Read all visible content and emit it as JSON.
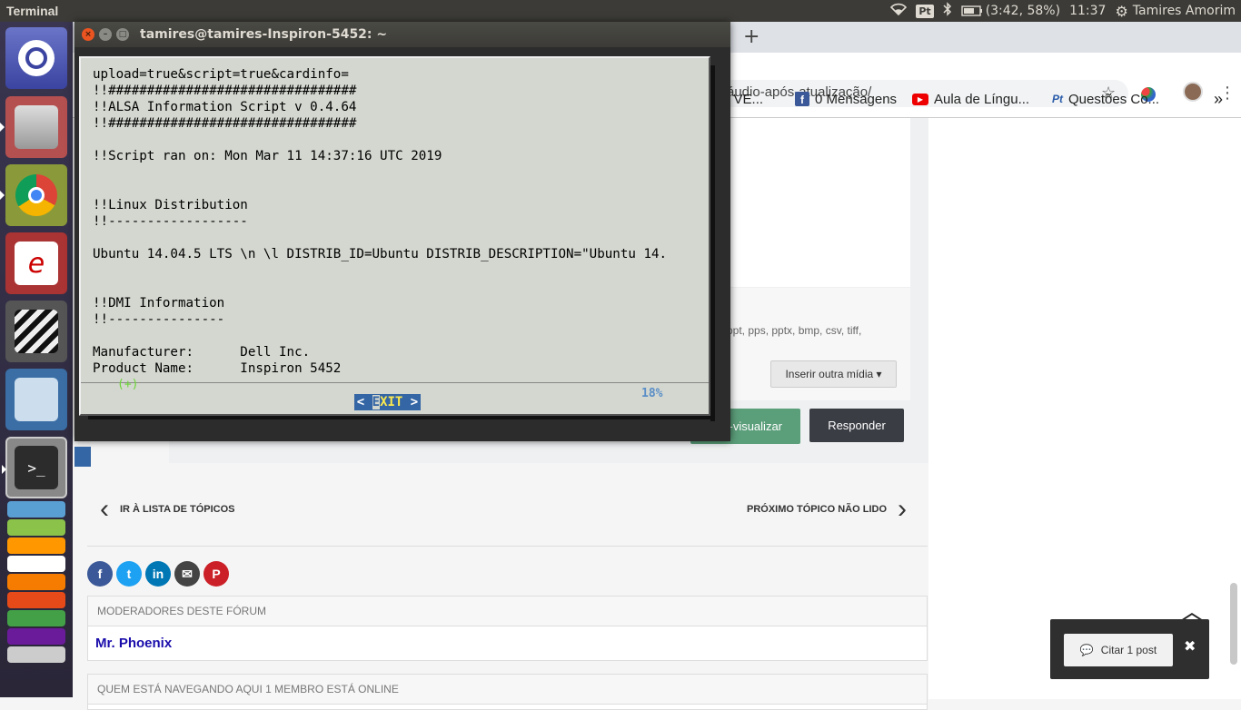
{
  "topbar": {
    "app_title": "Terminal",
    "keyboard_indicator": "Pt",
    "battery": "(3:42, 58%)",
    "clock": "11:37",
    "user": "Tamires Amorim"
  },
  "terminal": {
    "window_title": "tamires@tamires-Inspiron-5452: ~",
    "lines": [
      "upload=true&script=true&cardinfo=",
      "!!################################",
      "!!ALSA Information Script v 0.4.64",
      "!!################################",
      "",
      "!!Script ran on: Mon Mar 11 14:37:16 UTC 2019",
      "",
      "",
      "!!Linux Distribution",
      "!!------------------",
      "",
      "Ubuntu 14.04.5 LTS \\n \\l DISTRIB_ID=Ubuntu DISTRIB_DESCRIPTION=\"Ubuntu 14.",
      "",
      "",
      "!!DMI Information",
      "!!---------------",
      "",
      "Manufacturer:      Dell Inc.",
      "Product Name:      Inspiron 5452"
    ],
    "more_indicator": "(+)",
    "progress_text": "18%",
    "exit_left": "< ",
    "exit_first": "E",
    "exit_rest": "XIT",
    "exit_right": " >"
  },
  "browser": {
    "url_fragment": "áudio-após-atualização/",
    "bookmarks": [
      {
        "label": "A E VE...",
        "icon": "none"
      },
      {
        "label": "0 Mensagens",
        "icon": "facebook-icon"
      },
      {
        "label": "Aula de Língu...",
        "icon": "youtube-icon"
      },
      {
        "label": "Questões Co...",
        "icon": "qc-icon"
      }
    ],
    "more_bookmarks": "»"
  },
  "page": {
    "file_types": "ppt, pps, pptx, bmp, csv, tiff,",
    "insert_media": "Inserir outra mídia ▾",
    "preview_label": "-visualizar",
    "reply_label": "Responder",
    "back_to_list": "IR À LISTA DE TÓPICOS",
    "next_topic": "PRÓXIMO TÓPICO NÃO LIDO",
    "moderators_heading": "MODERADORES DESTE FÓRUM",
    "moderator_name": "Mr. Phoenix",
    "browsing_heading": "QUEM ESTÁ NAVEGANDO AQUI   1 MEMBRO ESTÁ ONLINE",
    "quote_button": "Citar 1 post",
    "close_glyph": "✖"
  },
  "colors": {
    "panel": "#3c3b37",
    "dialog_bg": "#d3d7cf",
    "dialog_button": "#3465a4",
    "preview_button": "#5b9e7a",
    "reply_button": "#3a3d44",
    "moderator_link": "#1a0dab"
  }
}
